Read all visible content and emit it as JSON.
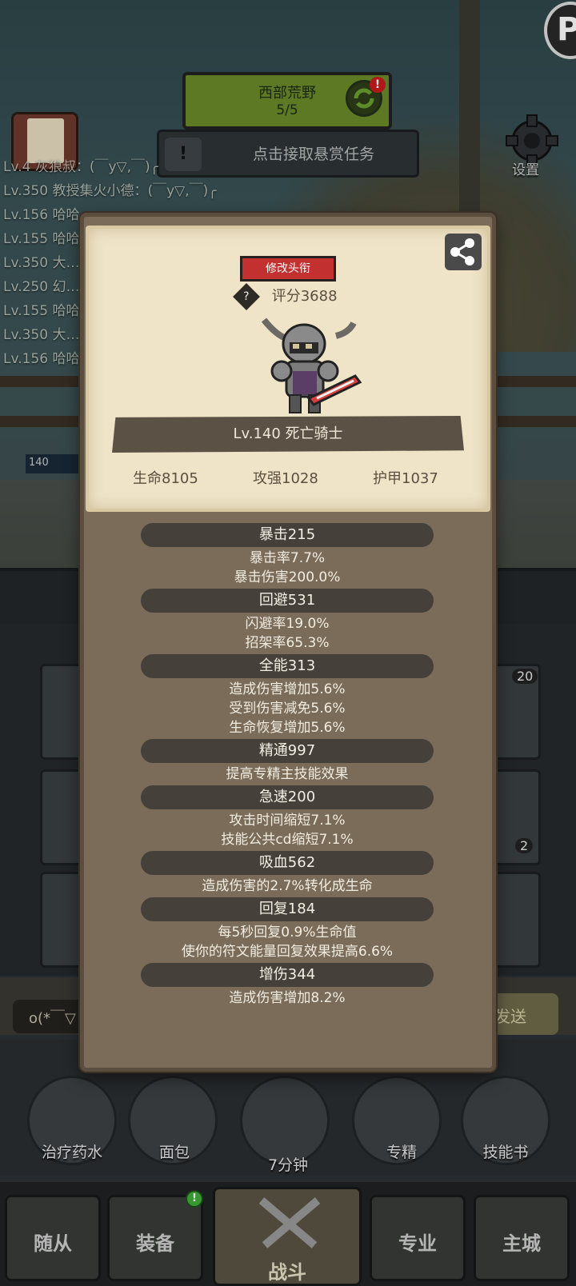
{
  "hud": {
    "region_name": "西部荒野",
    "region_progress": "5/5",
    "alert_mark": "!",
    "bounty_text": "点击接取悬赏任务",
    "bounty_icon": "!",
    "settings_label": "设置",
    "corner_badge": "P"
  },
  "chat_log": [
    "Lv.4 灰狼叔：(￣y▽,￣)╭",
    "Lv.350 教授集火小德：(￣y▽,￣)╭",
    "Lv.156 哈哈…",
    "Lv.155 哈哈…",
    "Lv.350 大…",
    "Lv.250 幻…",
    "Lv.155 哈哈…",
    "Lv.350 大…",
    "Lv.156 哈哈…"
  ],
  "hero_hp_tag": "140",
  "inventory_counts": [
    "20",
    "2"
  ],
  "chat": {
    "input_value": "o(*￣▽",
    "send_label": "发送"
  },
  "items": [
    {
      "label": "治疗药水"
    },
    {
      "label": "面包"
    },
    {
      "label": "7分钟"
    },
    {
      "label": "专精"
    },
    {
      "label": "技能书"
    }
  ],
  "nav": {
    "tabs": [
      "随从",
      "装备",
      "战斗",
      "专业",
      "主城"
    ],
    "equip_badge": "!"
  },
  "modal": {
    "rename_label": "修改头衔",
    "rating_icon": "?",
    "rating": "评分3688",
    "name_plate": "Lv.140 死亡骑士",
    "core_stats": {
      "hp": "生命8105",
      "attack": "攻强1028",
      "armor": "护甲1037"
    },
    "stats": [
      {
        "name": "暴击215",
        "lines": [
          "暴击率7.7%",
          "暴击伤害200.0%"
        ]
      },
      {
        "name": "回避531",
        "lines": [
          "闪避率19.0%",
          "招架率65.3%"
        ]
      },
      {
        "name": "全能313",
        "lines": [
          "造成伤害增加5.6%",
          "受到伤害减免5.6%",
          "生命恢复增加5.6%"
        ]
      },
      {
        "name": "精通997",
        "lines": [
          "提高专精主技能效果"
        ]
      },
      {
        "name": "急速200",
        "lines": [
          "攻击时间缩短7.1%",
          "技能公共cd缩短7.1%"
        ]
      },
      {
        "name": "吸血562",
        "lines": [
          "造成伤害的2.7%转化成生命"
        ]
      },
      {
        "name": "回复184",
        "lines": [
          "每5秒回复0.9%生命值",
          "使你的符文能量回复效果提高6.6%"
        ]
      },
      {
        "name": "增伤344",
        "lines": [
          "造成伤害增加8.2%"
        ]
      }
    ]
  },
  "colors": {
    "rename_red": "#c23030",
    "region_green": "#6a8a2a",
    "card_parchment": "#efe4c8",
    "modal_brown": "#7a6c58"
  },
  "icons": [
    "share-icon",
    "gear-icon",
    "refresh-icon",
    "task-scroll-icon",
    "potion-icon",
    "bread-icon",
    "chest-icon",
    "specialization-icon",
    "skill-book-icon",
    "crossed-swords-icon"
  ]
}
